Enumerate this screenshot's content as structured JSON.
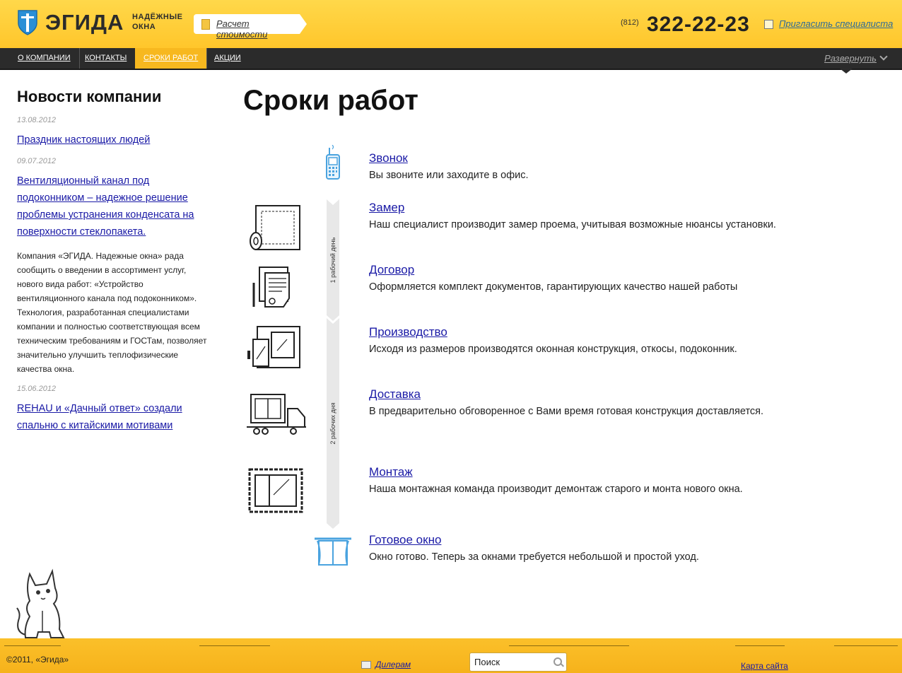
{
  "header": {
    "logo_word": "ЭГИДА",
    "logo_tagline": "НАДЁЖНЫЕ ОКНА",
    "calc_link": "Расчет стоимости",
    "phone_code": "(812)",
    "phone_number": "322-22-23",
    "invite_link": "Пригласить специалиста"
  },
  "nav": {
    "items": [
      "О КОМПАНИИ",
      "КОНТАКТЫ",
      "СРОКИ РАБОТ",
      "АКЦИИ"
    ],
    "active_index": 2,
    "expand_label": "Развернуть"
  },
  "sidebar": {
    "title": "Новости компании",
    "news": [
      {
        "date": "13.08.2012",
        "title": "Праздник настоящих людей"
      },
      {
        "date": "09.07.2012",
        "title": "Вентиляционный канал под подоконником – надежное решение проблемы устранения конденсата на поверхности стеклопакета.",
        "text": "Компания «ЭГИДА. Надежные окна» рада сообщить о введении в ассортимент услуг, нового вида работ: «Устройство вентиляционного канала под подоконником». Технология, разработанная специалистами компании и полностью соответствующая всем техническим требованиям и ГОСТам, позволяет значительно улучшить теплофизические качества окна."
      },
      {
        "date": "15.06.2012",
        "title": "REHAU и «Дачный ответ» создали спальню с китайскими мотивами"
      }
    ]
  },
  "main": {
    "title": "Сроки работ",
    "duration_labels": [
      "1 рабочий день",
      "2 рабочих дня"
    ],
    "steps": [
      {
        "title": "Звонок",
        "desc": "Вы звоните или заходите в офис.",
        "icon": "phone-icon"
      },
      {
        "title": "Замер",
        "desc": "Наш специалист производит замер проема, учитывая возможные нюансы установки.",
        "icon": "measure-icon"
      },
      {
        "title": "Договор",
        "desc": "Оформляется комплект документов, гарантирующих качество нашей работы",
        "icon": "contract-icon"
      },
      {
        "title": "Производство",
        "desc": "Исходя из размеров производятся оконная конструкция, откосы, подоконник.",
        "icon": "production-icon"
      },
      {
        "title": "Доставка",
        "desc": "В предварительно обговоренное с Вами время готовая конструкция доставляется.",
        "icon": "truck-icon"
      },
      {
        "title": "Монтаж",
        "desc": "Наша монтажная команда производит демонтаж старого и монта нового окна.",
        "icon": "install-icon"
      },
      {
        "title": "Готовое окно",
        "desc": "Окно готово. Теперь за окнами требуется небольшой и простой уход.",
        "icon": "window-icon"
      }
    ]
  },
  "footer": {
    "copyright": "©2011, «Эгида»",
    "dealers": "Дилерам",
    "search_value": "Поиск",
    "sitemap": "Карта сайта"
  },
  "colors": {
    "header_yellow": "#ffc62b",
    "nav_dark": "#2b2b2b",
    "nav_active": "#f7b81f",
    "link_blue": "#1a1aa6",
    "icon_blue": "#4aa3df"
  }
}
